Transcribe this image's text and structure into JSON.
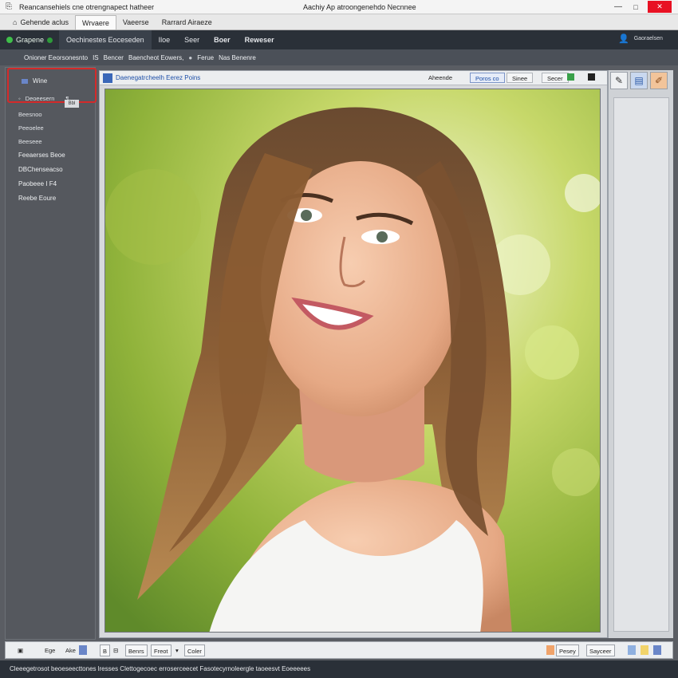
{
  "titlebar": {
    "doc_title": "Reancansehiels cne otrengnapect hatheer",
    "app_title": "Aachiy Ap atroongenehdo Necnnee",
    "minimize": "—",
    "maximize": "□",
    "close": "✕"
  },
  "tabs": [
    {
      "label": "Gehende aclus"
    },
    {
      "label": "Wrvaere"
    },
    {
      "label": "Vaeerse"
    },
    {
      "label": "Rarrard Airaeze"
    }
  ],
  "menubar": {
    "brand": "Grapene",
    "items": [
      "Oechinestes Eoceseden",
      "Iloe",
      "Seer",
      "Boer",
      "Reweser"
    ],
    "account": "Gaoraelsen"
  },
  "breadcrumb": [
    "Onioner Eeorsonesnto",
    "IS",
    "Bencer",
    "Baencheot Eowers,",
    "Ferue",
    "Nas Benenre"
  ],
  "leftpanel": {
    "top_item": "Wine",
    "sub_item": "Deoeesern",
    "badge": "Bbl",
    "items": [
      "Beesnoo",
      "Peeoelee",
      "Beeseee",
      "Feeaerses Beoe",
      "DBChenseacso",
      "Paobeee I F4",
      "Reebe Eoure"
    ]
  },
  "doc": {
    "label": "Daenegatrcheelh Eerez Poins",
    "buttons": [
      "Aheende",
      "Poros co",
      "Sinee",
      "Secer"
    ]
  },
  "bottombar": {
    "left_label": "Ege",
    "left_label2": "Ake",
    "seg1": "Benrs",
    "seg2": "Freot",
    "seg3": "Coler",
    "right1": "Pesey",
    "right2": "Sayceer"
  },
  "status_text": "Cleeegetrosot beoeseecttones lresses Clettogecoec erroserceecet Fasotecyrnoleergle taoeesvt Eoeeeees",
  "colors": {
    "accent": "#3a67b8",
    "highlight": "#d42a2a",
    "close": "#e81123"
  }
}
